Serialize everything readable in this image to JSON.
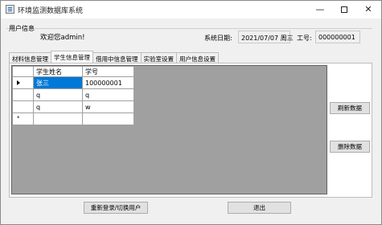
{
  "window": {
    "title": "环境监测数据库系统",
    "minimize": "—",
    "close": "✕"
  },
  "user_info": {
    "group_title": "用户信息",
    "welcome": "欢迎您admin!",
    "date_label": "系统日期:",
    "date_value": "2021/07/07 周三",
    "id_label": "工号:",
    "id_value": "000000001"
  },
  "tabs": [
    {
      "label": "材料信息管理"
    },
    {
      "label": "学生信息管理"
    },
    {
      "label": "借用中信息管理"
    },
    {
      "label": "实验室设置"
    },
    {
      "label": "用户信息设置"
    }
  ],
  "active_tab": 1,
  "grid": {
    "columns": [
      "学生姓名",
      "学号"
    ],
    "rows": [
      [
        "张三",
        "100000001"
      ],
      [
        "q",
        "q"
      ],
      [
        "q",
        "w"
      ],
      [
        "",
        ""
      ]
    ],
    "current_row_marker": "arrow",
    "new_row_marker": "*"
  },
  "buttons": {
    "refresh": "刷新数据",
    "delete": "删除数据",
    "relogin": "重新登录/切换用户",
    "exit": "退出"
  },
  "colors": {
    "selection": "#0078d7",
    "grid_background": "#a0a0a0",
    "form_background": "#f0f0f0"
  }
}
